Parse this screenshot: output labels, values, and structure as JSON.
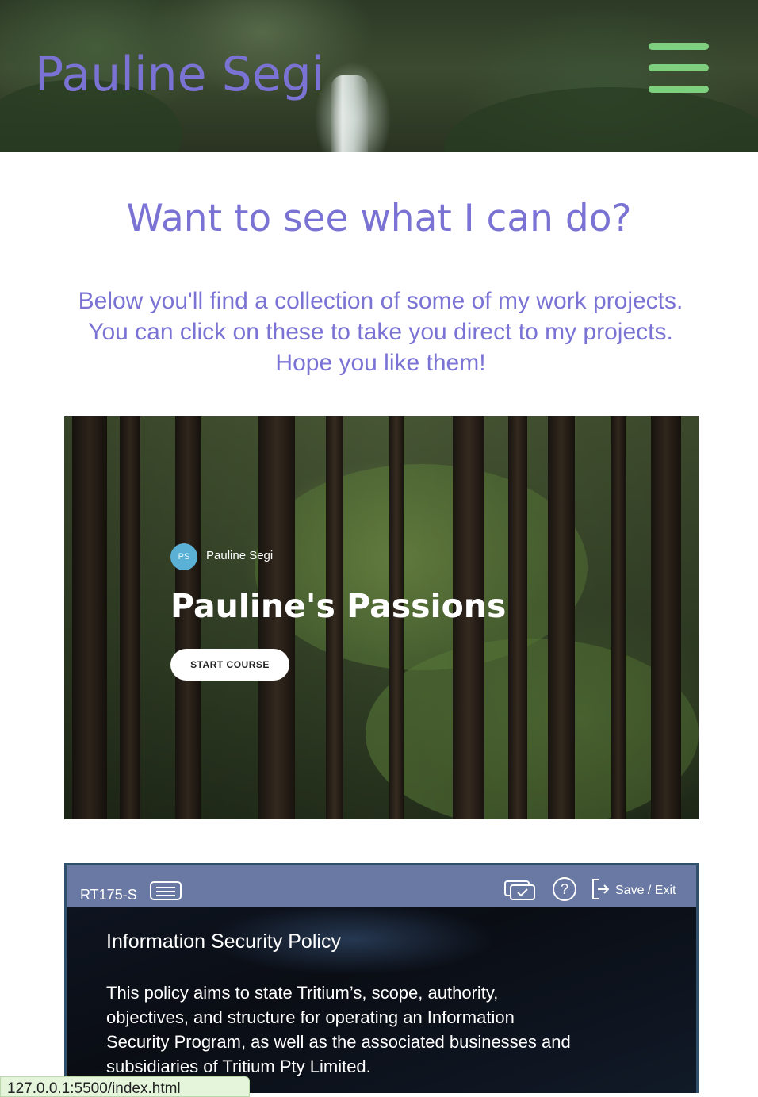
{
  "header": {
    "site_title": "Pauline Segi",
    "menu_icon": "hamburger-menu-icon",
    "menu_color": "#7ed07e",
    "title_color": "#7b73d4"
  },
  "intro": {
    "heading": "Want to see what I can do?",
    "lines": [
      "Below you'll find a collection of some of my work projects.",
      "You can click on these to take you direct to my projects.",
      "Hope you like them!"
    ]
  },
  "projects": [
    {
      "avatar_initials": "PS",
      "author": "Pauline Segi",
      "title": "Pauline's Passions",
      "button_label": "START COURSE"
    },
    {
      "course_code": "RT175-S",
      "save_exit_label": "Save / Exit",
      "help_label": "?",
      "title": "Information Security Policy",
      "body_lines": [
        "This policy aims to state Tritium’s, scope, authority,",
        "objectives, and structure for operating an Information",
        "Security Program, as well as the associated businesses and",
        "subsidiaries of Tritium Pty Limited."
      ]
    }
  ],
  "status_bar": {
    "url": "127.0.0.1:5500/index.html"
  }
}
